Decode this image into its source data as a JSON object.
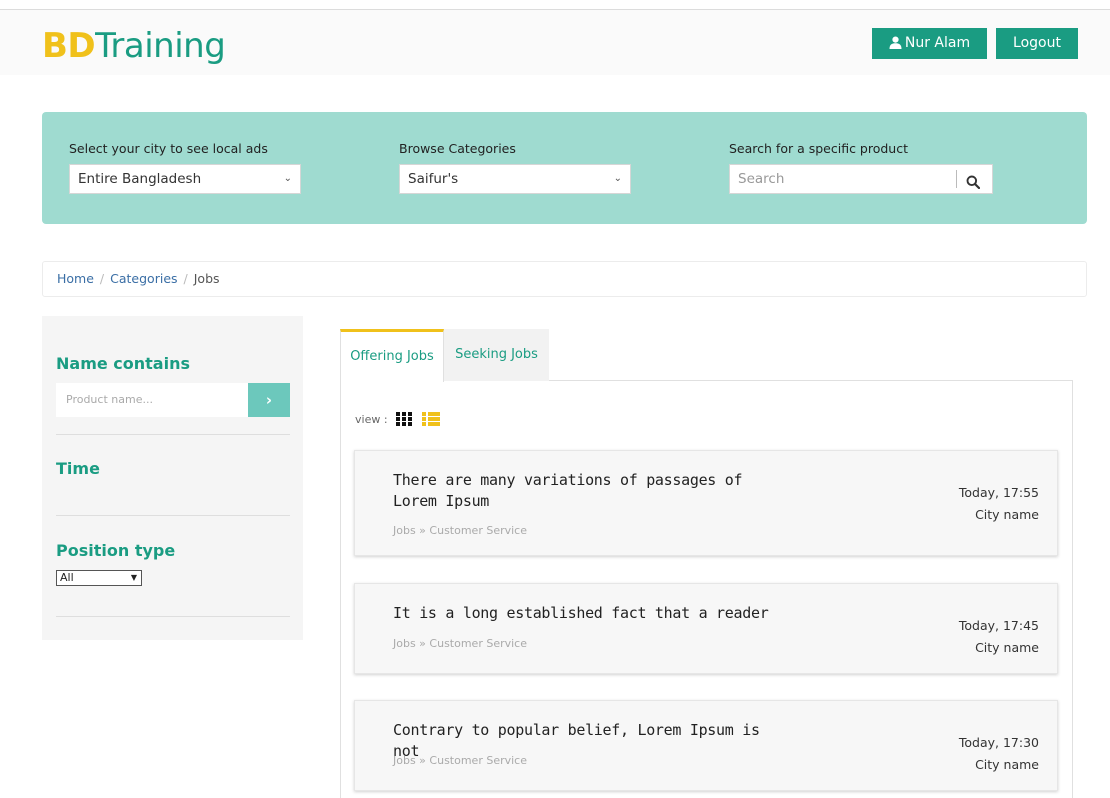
{
  "header": {
    "logo_part1": "BD",
    "logo_part2": "Training",
    "user_name": "Nur Alam",
    "logout_label": "Logout"
  },
  "search_panel": {
    "city_label": "Select your city to see local ads",
    "city_value": "Entire Bangladesh",
    "category_label": "Browse Categories",
    "category_value": "Saifur's",
    "search_label": "Search for a specific product",
    "search_placeholder": "Search"
  },
  "breadcrumb": {
    "items": [
      "Home",
      "Categories",
      "Jobs"
    ],
    "separator": "/"
  },
  "sidebar": {
    "name_title": "Name contains",
    "name_placeholder": "Product name...",
    "go_icon": "›",
    "time_title": "Time",
    "position_title": "Position type",
    "position_value": "All"
  },
  "tabs": [
    {
      "label": "Offering Jobs",
      "active": true
    },
    {
      "label": "Seeking Jobs",
      "active": false
    }
  ],
  "view_label": "view :",
  "listings": [
    {
      "title": "There are many variations of passages of Lorem Ipsum",
      "category": "Jobs » Customer Service",
      "time": "Today, 17:55",
      "city": "City name"
    },
    {
      "title": "It is a long established fact that a reader",
      "category": "Jobs » Customer Service",
      "time": "Today, 17:45",
      "city": "City name"
    },
    {
      "title": "Contrary to popular belief, Lorem Ipsum is not",
      "category": "Jobs » Customer Service",
      "time": "Today, 17:30",
      "city": "City name"
    }
  ],
  "colors": {
    "brand_green": "#1a9c82",
    "brand_yellow": "#f0c11b",
    "search_panel_bg": "#9fdbd0"
  },
  "icons": {
    "user": "user-icon",
    "search": "search-icon",
    "go": "chevron-right-icon",
    "grid_view": "grid-view-icon",
    "list_view": "list-view-icon"
  }
}
